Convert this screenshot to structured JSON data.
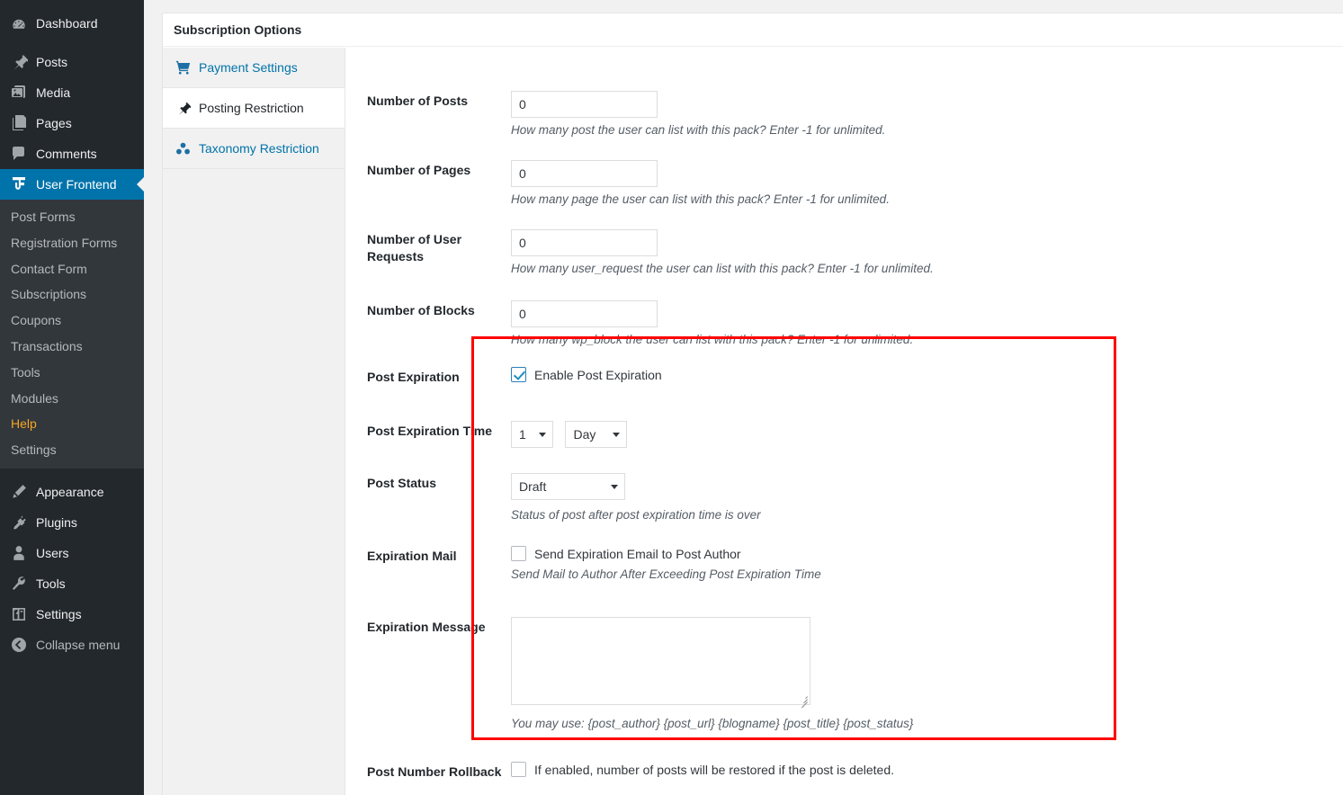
{
  "admin_menu": {
    "top_items": [
      {
        "label": "Dashboard",
        "icon": "dashboard-icon"
      },
      {
        "label": "Posts",
        "icon": "pin-icon"
      },
      {
        "label": "Media",
        "icon": "media-icon"
      },
      {
        "label": "Pages",
        "icon": "pages-icon"
      },
      {
        "label": "Comments",
        "icon": "comments-icon"
      },
      {
        "label": "User Frontend",
        "icon": "user-frontend-icon",
        "current": true
      }
    ],
    "submenu_items": [
      {
        "label": "Post Forms"
      },
      {
        "label": "Registration Forms"
      },
      {
        "label": "Contact Form"
      },
      {
        "label": "Subscriptions"
      },
      {
        "label": "Coupons"
      },
      {
        "label": "Transactions"
      },
      {
        "label": "Tools"
      },
      {
        "label": "Modules"
      },
      {
        "label": "Help",
        "highlight": true
      },
      {
        "label": "Settings"
      }
    ],
    "bottom_items": [
      {
        "label": "Appearance",
        "icon": "appearance-icon"
      },
      {
        "label": "Plugins",
        "icon": "plugins-icon"
      },
      {
        "label": "Users",
        "icon": "users-icon"
      },
      {
        "label": "Tools",
        "icon": "tools-icon"
      },
      {
        "label": "Settings",
        "icon": "settings-icon"
      },
      {
        "label": "Collapse menu",
        "icon": "collapse-icon"
      }
    ],
    "colors": {
      "background": "#23282d",
      "submenu_background": "#32373c",
      "current": "#0073aa",
      "help": "#f5a623"
    }
  },
  "metabox": {
    "title": "Subscription Options",
    "tabs": [
      {
        "label": "Payment Settings",
        "icon": "cart-icon",
        "active": false
      },
      {
        "label": "Posting Restriction",
        "icon": "pin-icon",
        "active": true
      },
      {
        "label": "Taxonomy Restriction",
        "icon": "taxonomy-icon",
        "active": false
      }
    ]
  },
  "form": {
    "number_of_posts": {
      "label": "Number of Posts",
      "value": "0",
      "desc": "How many post the user can list with this pack? Enter -1 for unlimited."
    },
    "number_of_pages": {
      "label": "Number of Pages",
      "value": "0",
      "desc": "How many page the user can list with this pack? Enter -1 for unlimited."
    },
    "number_of_user_requests": {
      "label": "Number of User Requests",
      "value": "0",
      "desc": "How many user_request the user can list with this pack? Enter -1 for unlimited."
    },
    "number_of_blocks": {
      "label": "Number of Blocks",
      "value": "0",
      "desc": "How many wp_block the user can list with this pack? Enter -1 for unlimited."
    },
    "post_expiration": {
      "label": "Post Expiration",
      "checkbox_label": "Enable Post Expiration",
      "checked": true
    },
    "post_expiration_time": {
      "label": "Post Expiration Time",
      "number_value": "1",
      "unit_value": "Day"
    },
    "post_status": {
      "label": "Post Status",
      "value": "Draft",
      "desc": "Status of post after post expiration time is over"
    },
    "expiration_mail": {
      "label": "Expiration Mail",
      "checkbox_label": "Send Expiration Email to Post Author",
      "checked": false,
      "desc": "Send Mail to Author After Exceeding Post Expiration Time"
    },
    "expiration_message": {
      "label": "Expiration Message",
      "value": "",
      "desc": "You may use: {post_author} {post_url} {blogname} {post_title} {post_status}"
    },
    "post_number_rollback": {
      "label": "Post Number Rollback",
      "checkbox_label": "If enabled, number of posts will be restored if the post is deleted.",
      "checked": false
    }
  },
  "annotation": {
    "highlight_color": "#ff0000"
  }
}
